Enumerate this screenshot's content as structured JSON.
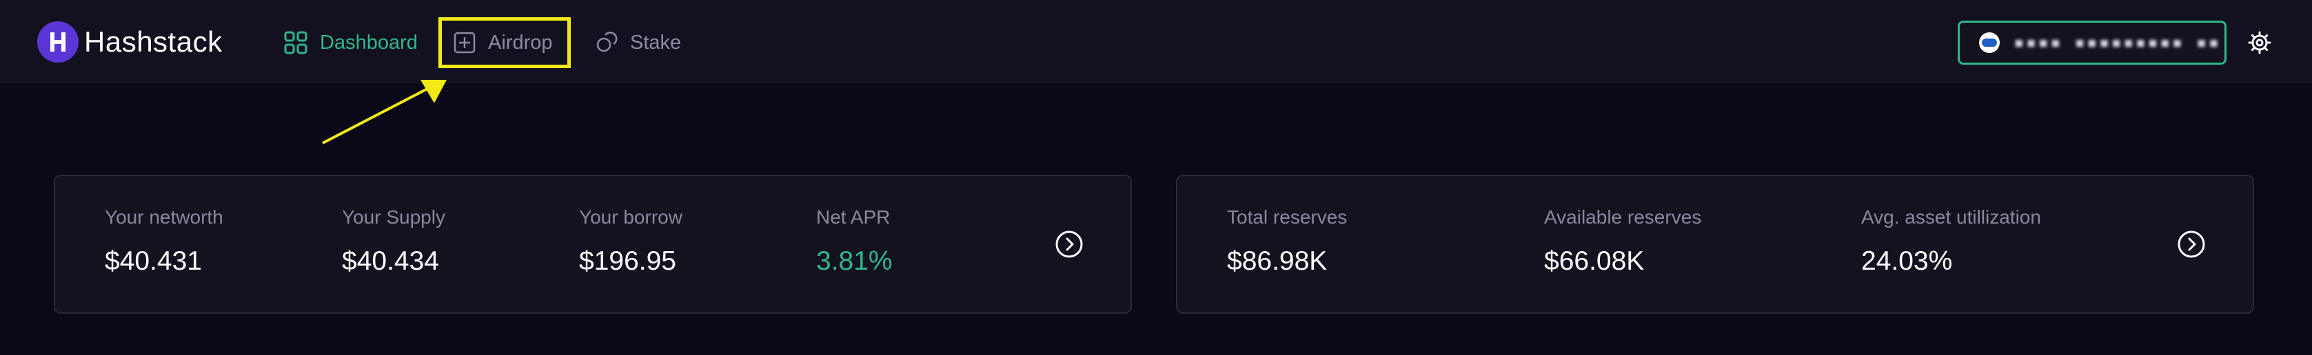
{
  "brand": {
    "name": "Hashstack",
    "logo_letter": "H"
  },
  "nav": {
    "items": [
      {
        "label": "Dashboard",
        "icon": "grid-icon",
        "active": true
      },
      {
        "label": "Airdrop",
        "icon": "plus-square-icon",
        "active": false
      },
      {
        "label": "Stake",
        "icon": "coins-icon",
        "active": false
      }
    ]
  },
  "wallet": {
    "address": "▪▪▪▪ ▪▪▪▪▪▪▪▪▪ ▪▪"
  },
  "user_stats": {
    "items": [
      {
        "label": "Your networth",
        "value": "$40.431"
      },
      {
        "label": "Your Supply",
        "value": "$40.434"
      },
      {
        "label": "Your borrow",
        "value": "$196.95"
      },
      {
        "label": "Net APR",
        "value": "3.81%"
      }
    ]
  },
  "market_stats": {
    "items": [
      {
        "label": "Total reserves",
        "value": "$86.98K"
      },
      {
        "label": "Available reserves",
        "value": "$66.08K"
      },
      {
        "label": "Avg. asset utillization",
        "value": "24.03%"
      }
    ]
  },
  "colors": {
    "accent": "#2fb889",
    "brand": "#5b36d6",
    "highlight": "#f1ea16",
    "background": "#0b0817",
    "card": "#15121f"
  }
}
